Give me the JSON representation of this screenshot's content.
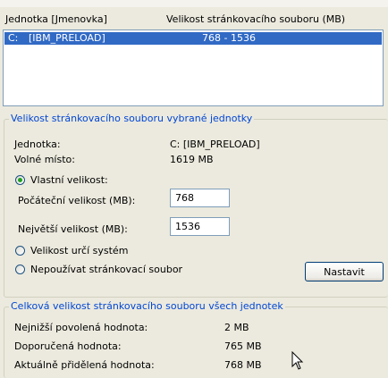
{
  "drive_list": {
    "col_drive_header": "Jednotka [Jmenovka]",
    "col_size_header": "Velikost stránkovacího souboru (MB)",
    "rows": [
      {
        "drive": "C:",
        "label": "[IBM_PRELOAD]",
        "size": "768 - 1536",
        "selected": true
      }
    ]
  },
  "selected_drive_group": {
    "title": "Velikost stránkovacího souboru vybrané jednotky",
    "drive_label": "Jednotka:",
    "drive_value": "C:  [IBM_PRELOAD]",
    "free_label": "Volné místo:",
    "free_value": "1619 MB",
    "custom_size_label": "Vlastní velikost:",
    "custom_size_selected": true,
    "initial_label": "Počáteční velikost (MB):",
    "initial_value": "768",
    "max_label": "Největší velikost (MB):",
    "max_value": "1536",
    "system_managed_label": "Velikost určí systém",
    "no_paging_label": "Nepoužívat stránkovací soubor",
    "set_button": "Nastavit"
  },
  "total_group": {
    "title": "Celková velikost stránkovacího souboru všech jednotek",
    "min_label": "Nejnižší povolená hodnota:",
    "min_value": "2 MB",
    "recommended_label": "Doporučená hodnota:",
    "recommended_value": "765 MB",
    "allocated_label": "Aktuálně přidělená hodnota:",
    "allocated_value": "768 MB"
  },
  "colors": {
    "window_bg": "#eceade",
    "selection": "#316ac5",
    "group_title": "#0046d5",
    "radio_dot": "#21a121"
  }
}
